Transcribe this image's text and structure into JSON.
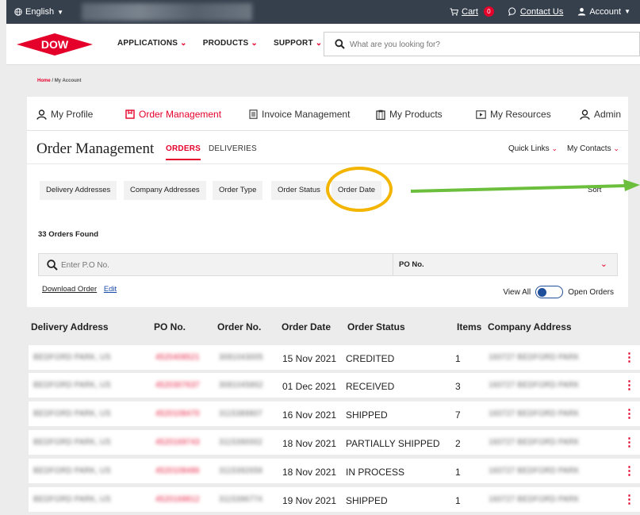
{
  "topbar": {
    "language": "English",
    "cart_label": "Cart",
    "cart_count": "0",
    "contact_label": "Contact Us",
    "account_label": "Account"
  },
  "header": {
    "logo_text": "DOW",
    "nav": [
      {
        "label": "APPLICATIONS"
      },
      {
        "label": "PRODUCTS"
      },
      {
        "label": "SUPPORT"
      }
    ],
    "search_placeholder": "What are you looking for?"
  },
  "breadcrumb": {
    "home": "Home",
    "separator": "/",
    "current": "My Account"
  },
  "account_tabs": [
    {
      "label": "My Profile",
      "icon": "user-icon"
    },
    {
      "label": "Order Management",
      "icon": "order-icon"
    },
    {
      "label": "Invoice Management",
      "icon": "invoice-icon"
    },
    {
      "label": "My Products",
      "icon": "clipboard-icon"
    },
    {
      "label": "My Resources",
      "icon": "video-icon"
    },
    {
      "label": "Admin",
      "icon": "admin-user-icon"
    }
  ],
  "order_management": {
    "title": "Order Management",
    "subtab_active": "ORDERS",
    "subtab_inactive": "DELIVERIES",
    "quick_links": "Quick Links",
    "my_contacts": "My Contacts"
  },
  "filters": [
    "Delivery Addresses",
    "Company Addresses",
    "Order Type",
    "Order Status",
    "Order Date"
  ],
  "sort_label": "Sort",
  "orders_found": "33 Orders Found",
  "po_search": {
    "placeholder": "Enter P.O No.",
    "selected": "PO No."
  },
  "links": {
    "download": "Download Order",
    "edit": "Edit"
  },
  "toggle": {
    "left_label": "View All",
    "right_label": "Open Orders"
  },
  "table": {
    "columns": [
      "Delivery Address",
      "PO No.",
      "Order No.",
      "Order Date",
      "Order Status",
      "Items",
      "Company Address"
    ],
    "rows": [
      {
        "date": "15 Nov 2021",
        "status": "CREDITED",
        "items": "1"
      },
      {
        "date": "01 Dec 2021",
        "status": "RECEIVED",
        "items": "3"
      },
      {
        "date": "16 Nov 2021",
        "status": "SHIPPED",
        "items": "7"
      },
      {
        "date": "18 Nov 2021",
        "status": "PARTIALLY SHIPPED",
        "items": "2"
      },
      {
        "date": "18 Nov 2021",
        "status": "IN PROCESS",
        "items": "1"
      },
      {
        "date": "19 Nov 2021",
        "status": "SHIPPED",
        "items": "1"
      }
    ]
  },
  "colors": {
    "brand_red": "#e4002b",
    "topbar": "#36404d",
    "highlight_circle": "#f3b500",
    "arrow": "#6cbf3c",
    "toggle_blue": "#1f4e9b"
  }
}
